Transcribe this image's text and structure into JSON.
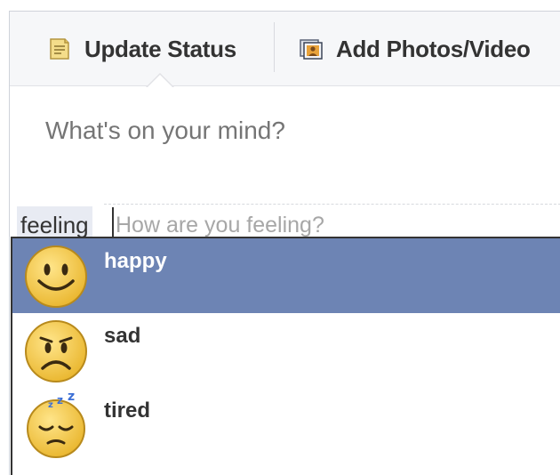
{
  "composer": {
    "tabs": [
      {
        "label": "Update Status",
        "icon": "status-note-icon"
      },
      {
        "label": "Add Photos/Video",
        "icon": "photo-icon"
      }
    ],
    "placeholder": "What's on your mind?"
  },
  "feeling": {
    "tag": "feeling",
    "placeholder": "How are you feeling?"
  },
  "options": [
    {
      "label": "happy",
      "icon": "happy-face-icon",
      "selected": true
    },
    {
      "label": "sad",
      "icon": "sad-face-icon",
      "selected": false
    },
    {
      "label": "tired",
      "icon": "tired-face-icon",
      "selected": false
    }
  ],
  "colors": {
    "selected_row": "#6d84b4",
    "emoji_fill": "#f7c948"
  }
}
